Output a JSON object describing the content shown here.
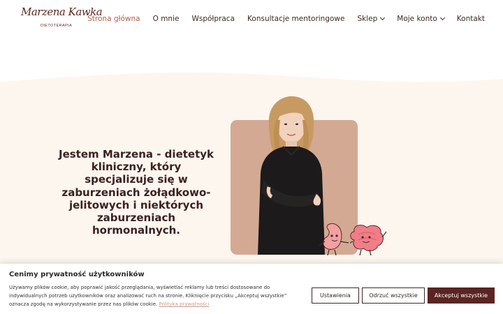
{
  "logo": {
    "script": "Marzena Kawka",
    "subtitle": "DIETOTERAPIA"
  },
  "nav": {
    "items": [
      {
        "label": "Strona główna",
        "active": true,
        "dropdown": false
      },
      {
        "label": "O mnie",
        "active": false,
        "dropdown": false
      },
      {
        "label": "Współpraca",
        "active": false,
        "dropdown": false
      },
      {
        "label": "Konsultacje mentoringowe",
        "active": false,
        "dropdown": false
      },
      {
        "label": "Sklep",
        "active": false,
        "dropdown": true
      },
      {
        "label": "Moje konto",
        "active": false,
        "dropdown": true
      },
      {
        "label": "Kontakt",
        "active": false,
        "dropdown": false
      }
    ]
  },
  "hero": {
    "headline": "Jestem Marzena - dietetyk kliniczny, który specjalizuje się w zaburzeniach żołądkowo-jelitowych i niektórych zaburzeniach hormonalnych."
  },
  "cookie": {
    "title": "Cenimy prywatność użytkowników",
    "body": "Używamy plików cookie, aby poprawić jakość przeglądania, wyświetlać reklamy lub treści dostosowane do indywidualnych potrzeb użytkowników oraz analizować ruch na stronie. Kliknięcie przycisku „Akceptuj wszystkie” oznacza zgodę na wykorzystywanie przez nas plików cookie.",
    "policy_link": "Polityka prywatności",
    "settings_label": "Ustawienia",
    "reject_label": "Odrzuć wszystkie",
    "accept_label": "Akceptuj wszystkie"
  },
  "colors": {
    "accent": "#b4604e",
    "brand_dark": "#5a2422",
    "hero_bg": "#fcf6ef",
    "photo_bg": "#d3a993"
  }
}
